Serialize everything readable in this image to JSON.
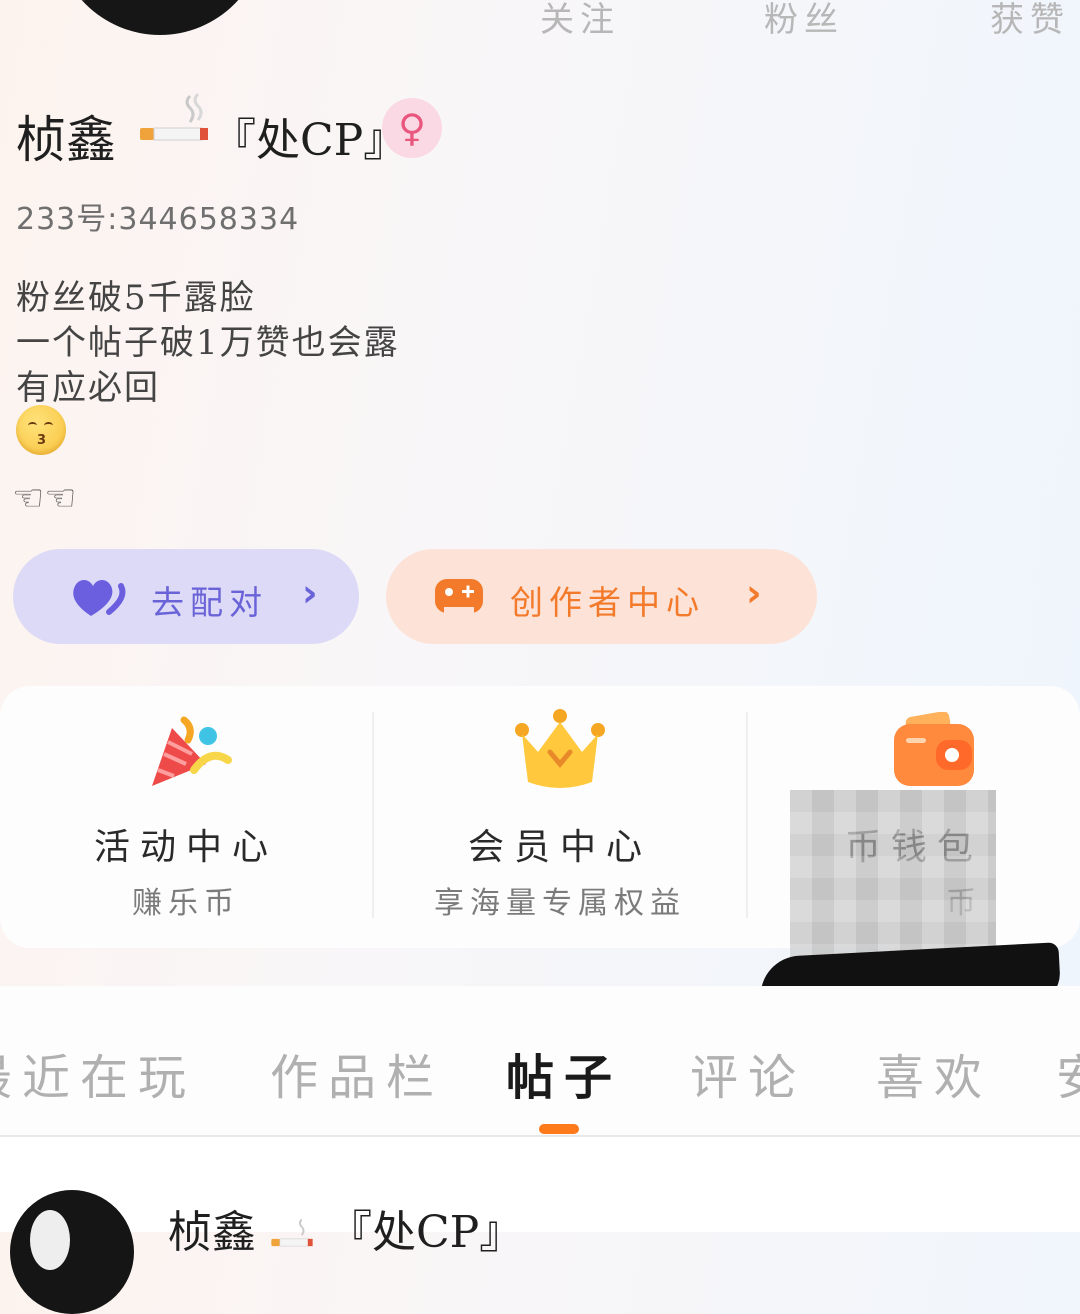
{
  "header": {
    "stats": [
      {
        "label": "关注"
      },
      {
        "label": "粉丝"
      },
      {
        "label": "获赞"
      }
    ]
  },
  "profile": {
    "name": "桢鑫",
    "name_tag": "『处CP』",
    "gender_symbol": "♀",
    "uid": "233号:344658334",
    "bio": [
      "粉丝破5千露脸",
      "一个帖子破1万赞也会露",
      "有应必回"
    ],
    "emoji_hands": "☜☜"
  },
  "actions": {
    "match_label": "去配对",
    "creator_label": "创作者中心",
    "chevron": "›"
  },
  "shortcuts": [
    {
      "title": "活动中心",
      "subtitle": "赚乐币",
      "icon": "party-popper-icon"
    },
    {
      "title": "会员中心",
      "subtitle": "享海量专属权益",
      "icon": "crown-icon"
    },
    {
      "title": "币钱包",
      "subtitle": "币",
      "icon": "wallet-icon"
    }
  ],
  "tabs": [
    {
      "label": "最近在玩"
    },
    {
      "label": "作品栏"
    },
    {
      "label": "帖子"
    },
    {
      "label": "评论"
    },
    {
      "label": "喜欢"
    },
    {
      "label": "安"
    }
  ],
  "post": {
    "author": "桢鑫",
    "author_tag": "『处CP』"
  },
  "colors": {
    "accent": "#ff7a1a",
    "match_pill_bg": "#dcdaf6",
    "match_text": "#6a63d8",
    "creator_pill_bg": "#fde3d7",
    "creator_text": "#f37a2b",
    "gender_pink": "#e9577f"
  }
}
